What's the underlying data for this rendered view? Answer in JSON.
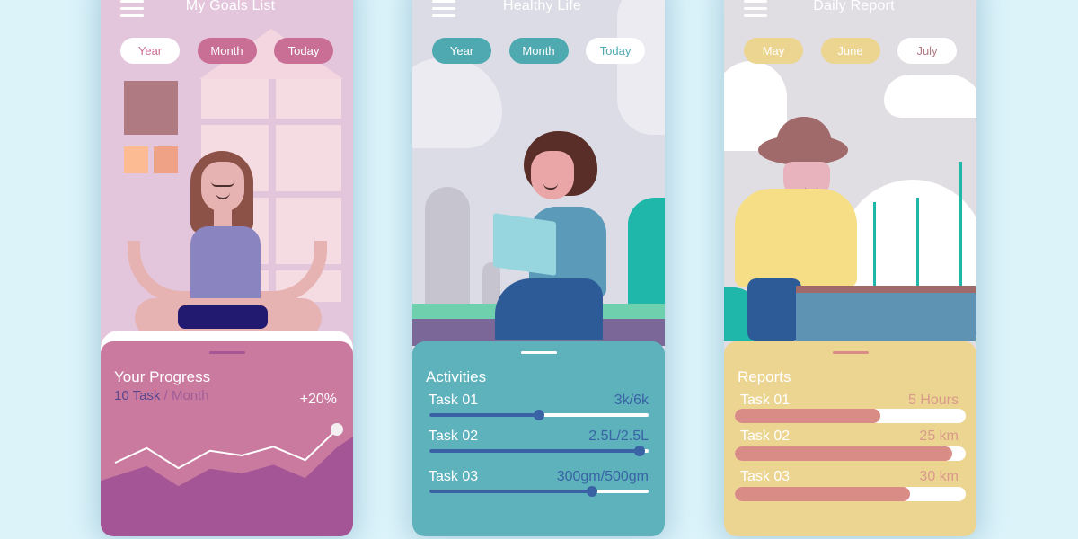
{
  "colors": {
    "page_bg": "#dcf3fa",
    "goals_accent": "#c96f95",
    "goals_sheet": "#cb7a9f",
    "goals_area": "#a45596",
    "health_accent": "#4fa9b1",
    "health_sheet": "#5db2bc",
    "health_slider": "#3a63a5",
    "report_accent": "#ecd591",
    "report_bar": "#d98b86"
  },
  "screens": [
    {
      "title": "My Goals List",
      "menu_icon": "hamburger-menu-icon",
      "pills": [
        {
          "label": "Year",
          "active": true
        },
        {
          "label": "Month",
          "active": false
        },
        {
          "label": "Today",
          "active": false
        }
      ],
      "sheet": {
        "title": "Your Progress",
        "count_text": "10 Task",
        "period_text": "/ Month",
        "delta": "+20%",
        "trend_values": [
          2,
          4.2,
          1.2,
          3.8,
          3.1,
          4.4,
          2.4,
          7
        ]
      }
    },
    {
      "title": "Healthy Life",
      "menu_icon": "hamburger-menu-icon",
      "pills": [
        {
          "label": "Year",
          "active": false
        },
        {
          "label": "Month",
          "active": false
        },
        {
          "label": "Today",
          "active": true
        }
      ],
      "sheet": {
        "title": "Activities",
        "tasks": [
          {
            "label": "Task 01",
            "value": "3k/6k",
            "progress": 0.5
          },
          {
            "label": "Task 02",
            "value": "2.5L/2.5L",
            "progress": 0.96
          },
          {
            "label": "Task 03",
            "value": "300gm/500gm",
            "progress": 0.74
          }
        ]
      }
    },
    {
      "title": "Daily Report",
      "menu_icon": "hamburger-menu-icon",
      "pills": [
        {
          "label": "May",
          "active": false
        },
        {
          "label": "June",
          "active": false
        },
        {
          "label": "July",
          "active": true
        }
      ],
      "sheet": {
        "title": "Reports",
        "tasks": [
          {
            "label": "Task 01",
            "value": "5 Hours",
            "progress": 0.63
          },
          {
            "label": "Task 02",
            "value": "25 km",
            "progress": 0.94
          },
          {
            "label": "Task 03",
            "value": "30 km",
            "progress": 0.76
          }
        ]
      }
    }
  ]
}
